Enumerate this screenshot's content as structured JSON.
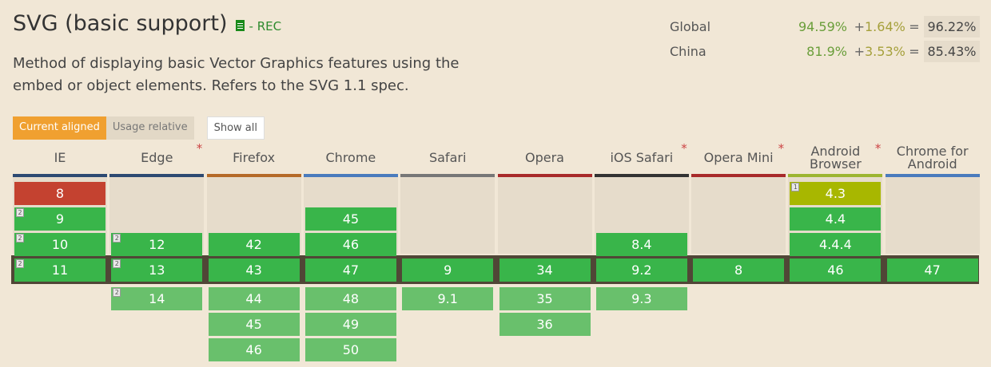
{
  "header": {
    "title": "SVG (basic support)",
    "spec_status": "- REC",
    "description": "Method of displaying basic Vector Graphics features using the embed or object elements. Refers to the SVG 1.1 spec."
  },
  "usage": [
    {
      "region": "Global",
      "supported": "94.59%",
      "plus": "+",
      "partial": "1.64%",
      "equals": "=",
      "total": "96.22%"
    },
    {
      "region": "China",
      "supported": "81.9%",
      "plus": "+",
      "partial": "3.53%",
      "equals": "=",
      "total": "85.43%"
    }
  ],
  "tabs": {
    "current": "Current aligned",
    "relative": "Usage relative",
    "show_all": "Show all"
  },
  "browsers": [
    {
      "name": "IE",
      "bar_color": "#2d4a72",
      "star": false
    },
    {
      "name": "Edge",
      "bar_color": "#2d4a72",
      "star": true
    },
    {
      "name": "Firefox",
      "bar_color": "#b56a28",
      "star": false
    },
    {
      "name": "Chrome",
      "bar_color": "#4a7bbd",
      "star": false
    },
    {
      "name": "Safari",
      "bar_color": "#777777",
      "star": false
    },
    {
      "name": "Opera",
      "bar_color": "#a82a2a",
      "star": false
    },
    {
      "name": "iOS Safari",
      "bar_color": "#333333",
      "star": true
    },
    {
      "name": "Opera Mini",
      "bar_color": "#a82a2a",
      "star": true
    },
    {
      "name": "Android Browser",
      "bar_color": "#9cb531",
      "star": true
    },
    {
      "name": "Chrome for Android",
      "bar_color": "#4a7bbd",
      "star": false
    }
  ],
  "star_symbol": "*",
  "columns": [
    {
      "cells": [
        {
          "row": -3,
          "version": "8",
          "status": "unsupported"
        },
        {
          "row": -2,
          "version": "9",
          "status": "supported",
          "note": "2"
        },
        {
          "row": -1,
          "version": "10",
          "status": "supported",
          "note": "2"
        },
        {
          "row": 0,
          "version": "11",
          "status": "supported",
          "note": "2"
        }
      ]
    },
    {
      "cells": [
        {
          "row": -1,
          "version": "12",
          "status": "supported",
          "note": "2"
        },
        {
          "row": 0,
          "version": "13",
          "status": "supported",
          "note": "2"
        },
        {
          "row": 1,
          "version": "14",
          "status": "future",
          "note": "2"
        }
      ]
    },
    {
      "cells": [
        {
          "row": -1,
          "version": "42",
          "status": "supported"
        },
        {
          "row": 0,
          "version": "43",
          "status": "supported"
        },
        {
          "row": 1,
          "version": "44",
          "status": "future"
        },
        {
          "row": 2,
          "version": "45",
          "status": "future"
        },
        {
          "row": 3,
          "version": "46",
          "status": "future"
        }
      ]
    },
    {
      "cells": [
        {
          "row": -2,
          "version": "45",
          "status": "supported"
        },
        {
          "row": -1,
          "version": "46",
          "status": "supported"
        },
        {
          "row": 0,
          "version": "47",
          "status": "supported"
        },
        {
          "row": 1,
          "version": "48",
          "status": "future"
        },
        {
          "row": 2,
          "version": "49",
          "status": "future"
        },
        {
          "row": 3,
          "version": "50",
          "status": "future"
        }
      ]
    },
    {
      "cells": [
        {
          "row": 0,
          "version": "9",
          "status": "supported"
        },
        {
          "row": 1,
          "version": "9.1",
          "status": "future"
        }
      ]
    },
    {
      "cells": [
        {
          "row": 0,
          "version": "34",
          "status": "supported"
        },
        {
          "row": 1,
          "version": "35",
          "status": "future"
        },
        {
          "row": 2,
          "version": "36",
          "status": "future"
        }
      ]
    },
    {
      "cells": [
        {
          "row": -1,
          "version": "8.4",
          "status": "supported"
        },
        {
          "row": 0,
          "version": "9.2",
          "status": "supported"
        },
        {
          "row": 1,
          "version": "9.3",
          "status": "future"
        }
      ]
    },
    {
      "cells": [
        {
          "row": 0,
          "version": "8",
          "status": "supported"
        }
      ]
    },
    {
      "cells": [
        {
          "row": -3,
          "version": "4.3",
          "status": "partial",
          "note": "1"
        },
        {
          "row": -2,
          "version": "4.4",
          "status": "supported"
        },
        {
          "row": -1,
          "version": "4.4.4",
          "status": "supported"
        },
        {
          "row": 0,
          "version": "46",
          "status": "supported"
        }
      ]
    },
    {
      "cells": [
        {
          "row": 0,
          "version": "47",
          "status": "supported"
        }
      ]
    }
  ]
}
